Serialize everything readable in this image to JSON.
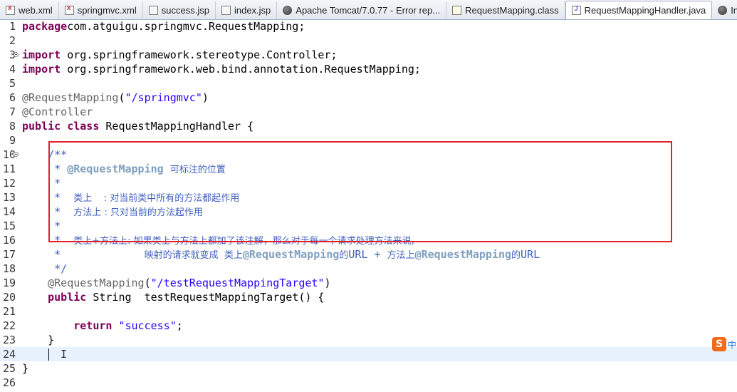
{
  "tabs": [
    {
      "label": "web.xml",
      "icon": "xml-file-icon"
    },
    {
      "label": "springmvc.xml",
      "icon": "xml-file-icon"
    },
    {
      "label": "success.jsp",
      "icon": "jsp-file-icon"
    },
    {
      "label": "index.jsp",
      "icon": "jsp-file-icon"
    },
    {
      "label": "Apache Tomcat/7.0.77 - Error rep...",
      "icon": "browser-globe-icon"
    },
    {
      "label": "RequestMapping.class",
      "icon": "class-file-icon"
    },
    {
      "label": "RequestMappingHandler.java",
      "icon": "java-file-icon",
      "active": true
    },
    {
      "label": "Insert",
      "icon": "browser-globe-icon"
    }
  ],
  "editor": {
    "lines": [
      {
        "n": "1",
        "tokens": [
          [
            "kw",
            "package"
          ],
          [
            "",
            "com.atguigu.springmvc.RequestMapping;"
          ]
        ]
      },
      {
        "n": "2",
        "tokens": []
      },
      {
        "n": "3",
        "fold": true,
        "tokens": [
          [
            "kw",
            "import"
          ],
          [
            "",
            " org.springframework.stereotype.Controller;"
          ]
        ]
      },
      {
        "n": "4",
        "tokens": [
          [
            "kw",
            "import"
          ],
          [
            "",
            " org.springframework.web.bind.annotation.RequestMapping;"
          ]
        ]
      },
      {
        "n": "5",
        "tokens": []
      },
      {
        "n": "6",
        "tokens": [
          [
            "ann",
            "@RequestMapping"
          ],
          [
            "",
            "("
          ],
          [
            "str",
            "\"/springmvc\""
          ],
          [
            "",
            ")"
          ]
        ]
      },
      {
        "n": "7",
        "tokens": [
          [
            "ann",
            "@Controller"
          ]
        ]
      },
      {
        "n": "8",
        "tokens": [
          [
            "kw",
            "public class"
          ],
          [
            "",
            " RequestMappingHandler {"
          ]
        ]
      },
      {
        "n": "9",
        "tokens": []
      },
      {
        "n": "10",
        "fold": true,
        "tokens": [
          [
            "cm",
            "    /**"
          ]
        ]
      },
      {
        "n": "11",
        "tokens": [
          [
            "cm",
            "     * "
          ],
          [
            "cm-tag",
            "@RequestMapping"
          ],
          [
            "cm",
            " "
          ],
          [
            "cm cjk",
            "可标注的位置"
          ]
        ]
      },
      {
        "n": "12",
        "tokens": [
          [
            "cm",
            "     *"
          ]
        ]
      },
      {
        "n": "13",
        "tokens": [
          [
            "cm",
            "     *  "
          ],
          [
            "cm cjk",
            "类上    : 对当前类中所有的方法都起作用"
          ]
        ]
      },
      {
        "n": "14",
        "tokens": [
          [
            "cm",
            "     *  "
          ],
          [
            "cm cjk",
            "方法上 : 只对当前的方法起作用"
          ]
        ]
      },
      {
        "n": "15",
        "tokens": [
          [
            "cm",
            "     *"
          ]
        ]
      },
      {
        "n": "16",
        "tokens": [
          [
            "cm",
            "     *  "
          ],
          [
            "cm cjk",
            "类上+方法上: 如果类上与方法上都加了该注解，那么对于每一个请求处理方法来说,"
          ]
        ]
      },
      {
        "n": "17",
        "tokens": [
          [
            "cm",
            "     *             "
          ],
          [
            "cm cjk",
            "映射的请求就变成  类上"
          ],
          [
            "cm-tag",
            "@RequestMapping"
          ],
          [
            "cm cjk",
            "的"
          ],
          [
            "cm",
            "URL + "
          ],
          [
            "cm cjk",
            "方法上"
          ],
          [
            "cm-tag",
            "@RequestMapping"
          ],
          [
            "cm cjk",
            "的"
          ],
          [
            "cm",
            "URL"
          ]
        ]
      },
      {
        "n": "18",
        "tokens": [
          [
            "cm",
            "     */"
          ]
        ]
      },
      {
        "n": "19",
        "tokens": [
          [
            "ann",
            "    @RequestMapping"
          ],
          [
            "",
            "("
          ],
          [
            "str",
            "\"/testRequestMappingTarget\""
          ],
          [
            "",
            ")"
          ]
        ]
      },
      {
        "n": "20",
        "tokens": [
          [
            "kw",
            "    public"
          ],
          [
            "",
            " String  testRequestMappingTarget() {"
          ]
        ]
      },
      {
        "n": "21",
        "tokens": []
      },
      {
        "n": "22",
        "tokens": [
          [
            "kw",
            "        return"
          ],
          [
            "",
            " "
          ],
          [
            "str",
            "\"success\""
          ],
          [
            "",
            ";"
          ]
        ]
      },
      {
        "n": "23",
        "tokens": [
          [
            "",
            "    }"
          ]
        ]
      },
      {
        "n": "24",
        "current": true,
        "tokens": []
      },
      {
        "n": "25",
        "tokens": [
          [
            "",
            "}"
          ]
        ]
      },
      {
        "n": "26",
        "tokens": []
      }
    ]
  },
  "ime": {
    "logo": "S",
    "mode": "中"
  },
  "colors": {
    "highlight_box": "#e0202a",
    "keyword": "#7f0055",
    "string": "#2a00ff",
    "comment": "#3f5fbf",
    "current_line": "#e8f2fe"
  }
}
